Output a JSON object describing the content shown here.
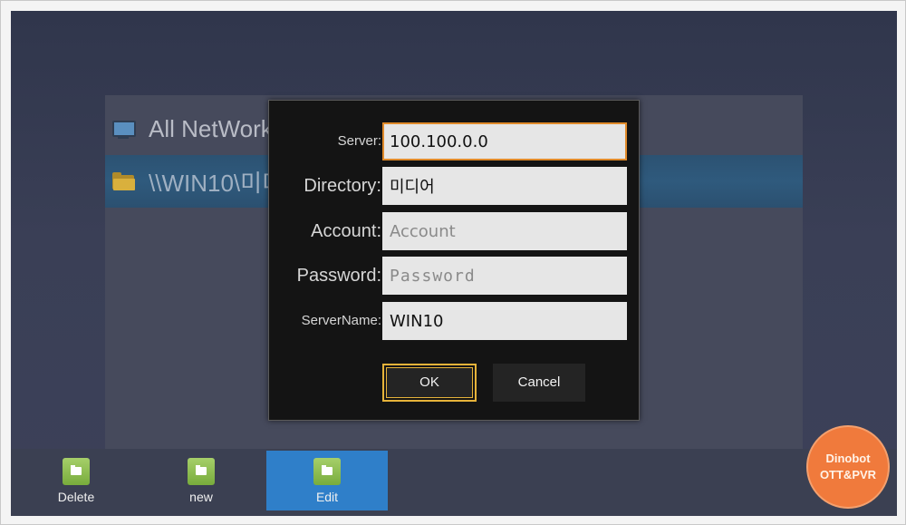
{
  "background_list": {
    "rows": [
      {
        "label": "All NetWork",
        "icon": "monitor-icon"
      },
      {
        "label": "\\\\WIN10\\미디어",
        "icon": "folder-icon"
      }
    ]
  },
  "dialog": {
    "server": {
      "label": "Server:",
      "value": "100.100.0.0"
    },
    "directory": {
      "label": "Directory:",
      "value": "미디어"
    },
    "account": {
      "label": "Account:",
      "value": "",
      "placeholder": "Account"
    },
    "password": {
      "label": "Password:",
      "value": "",
      "placeholder": "Password"
    },
    "server_name": {
      "label": "ServerName:",
      "value": "WIN10"
    },
    "ok_label": "OK",
    "cancel_label": "Cancel"
  },
  "toolbar": {
    "items": [
      {
        "label": "Delete",
        "icon": "folder-icon"
      },
      {
        "label": "new",
        "icon": "folder-icon"
      },
      {
        "label": "Edit",
        "icon": "folder-icon",
        "active": true
      }
    ]
  },
  "watermark": {
    "line1": "Dinobot",
    "line2": "OTT&PVR"
  },
  "colors": {
    "focus_border": "#e08a2a",
    "ok_border": "#e6b33a",
    "active_tool": "#2f7fc9",
    "watermark": "#f07a3c"
  }
}
